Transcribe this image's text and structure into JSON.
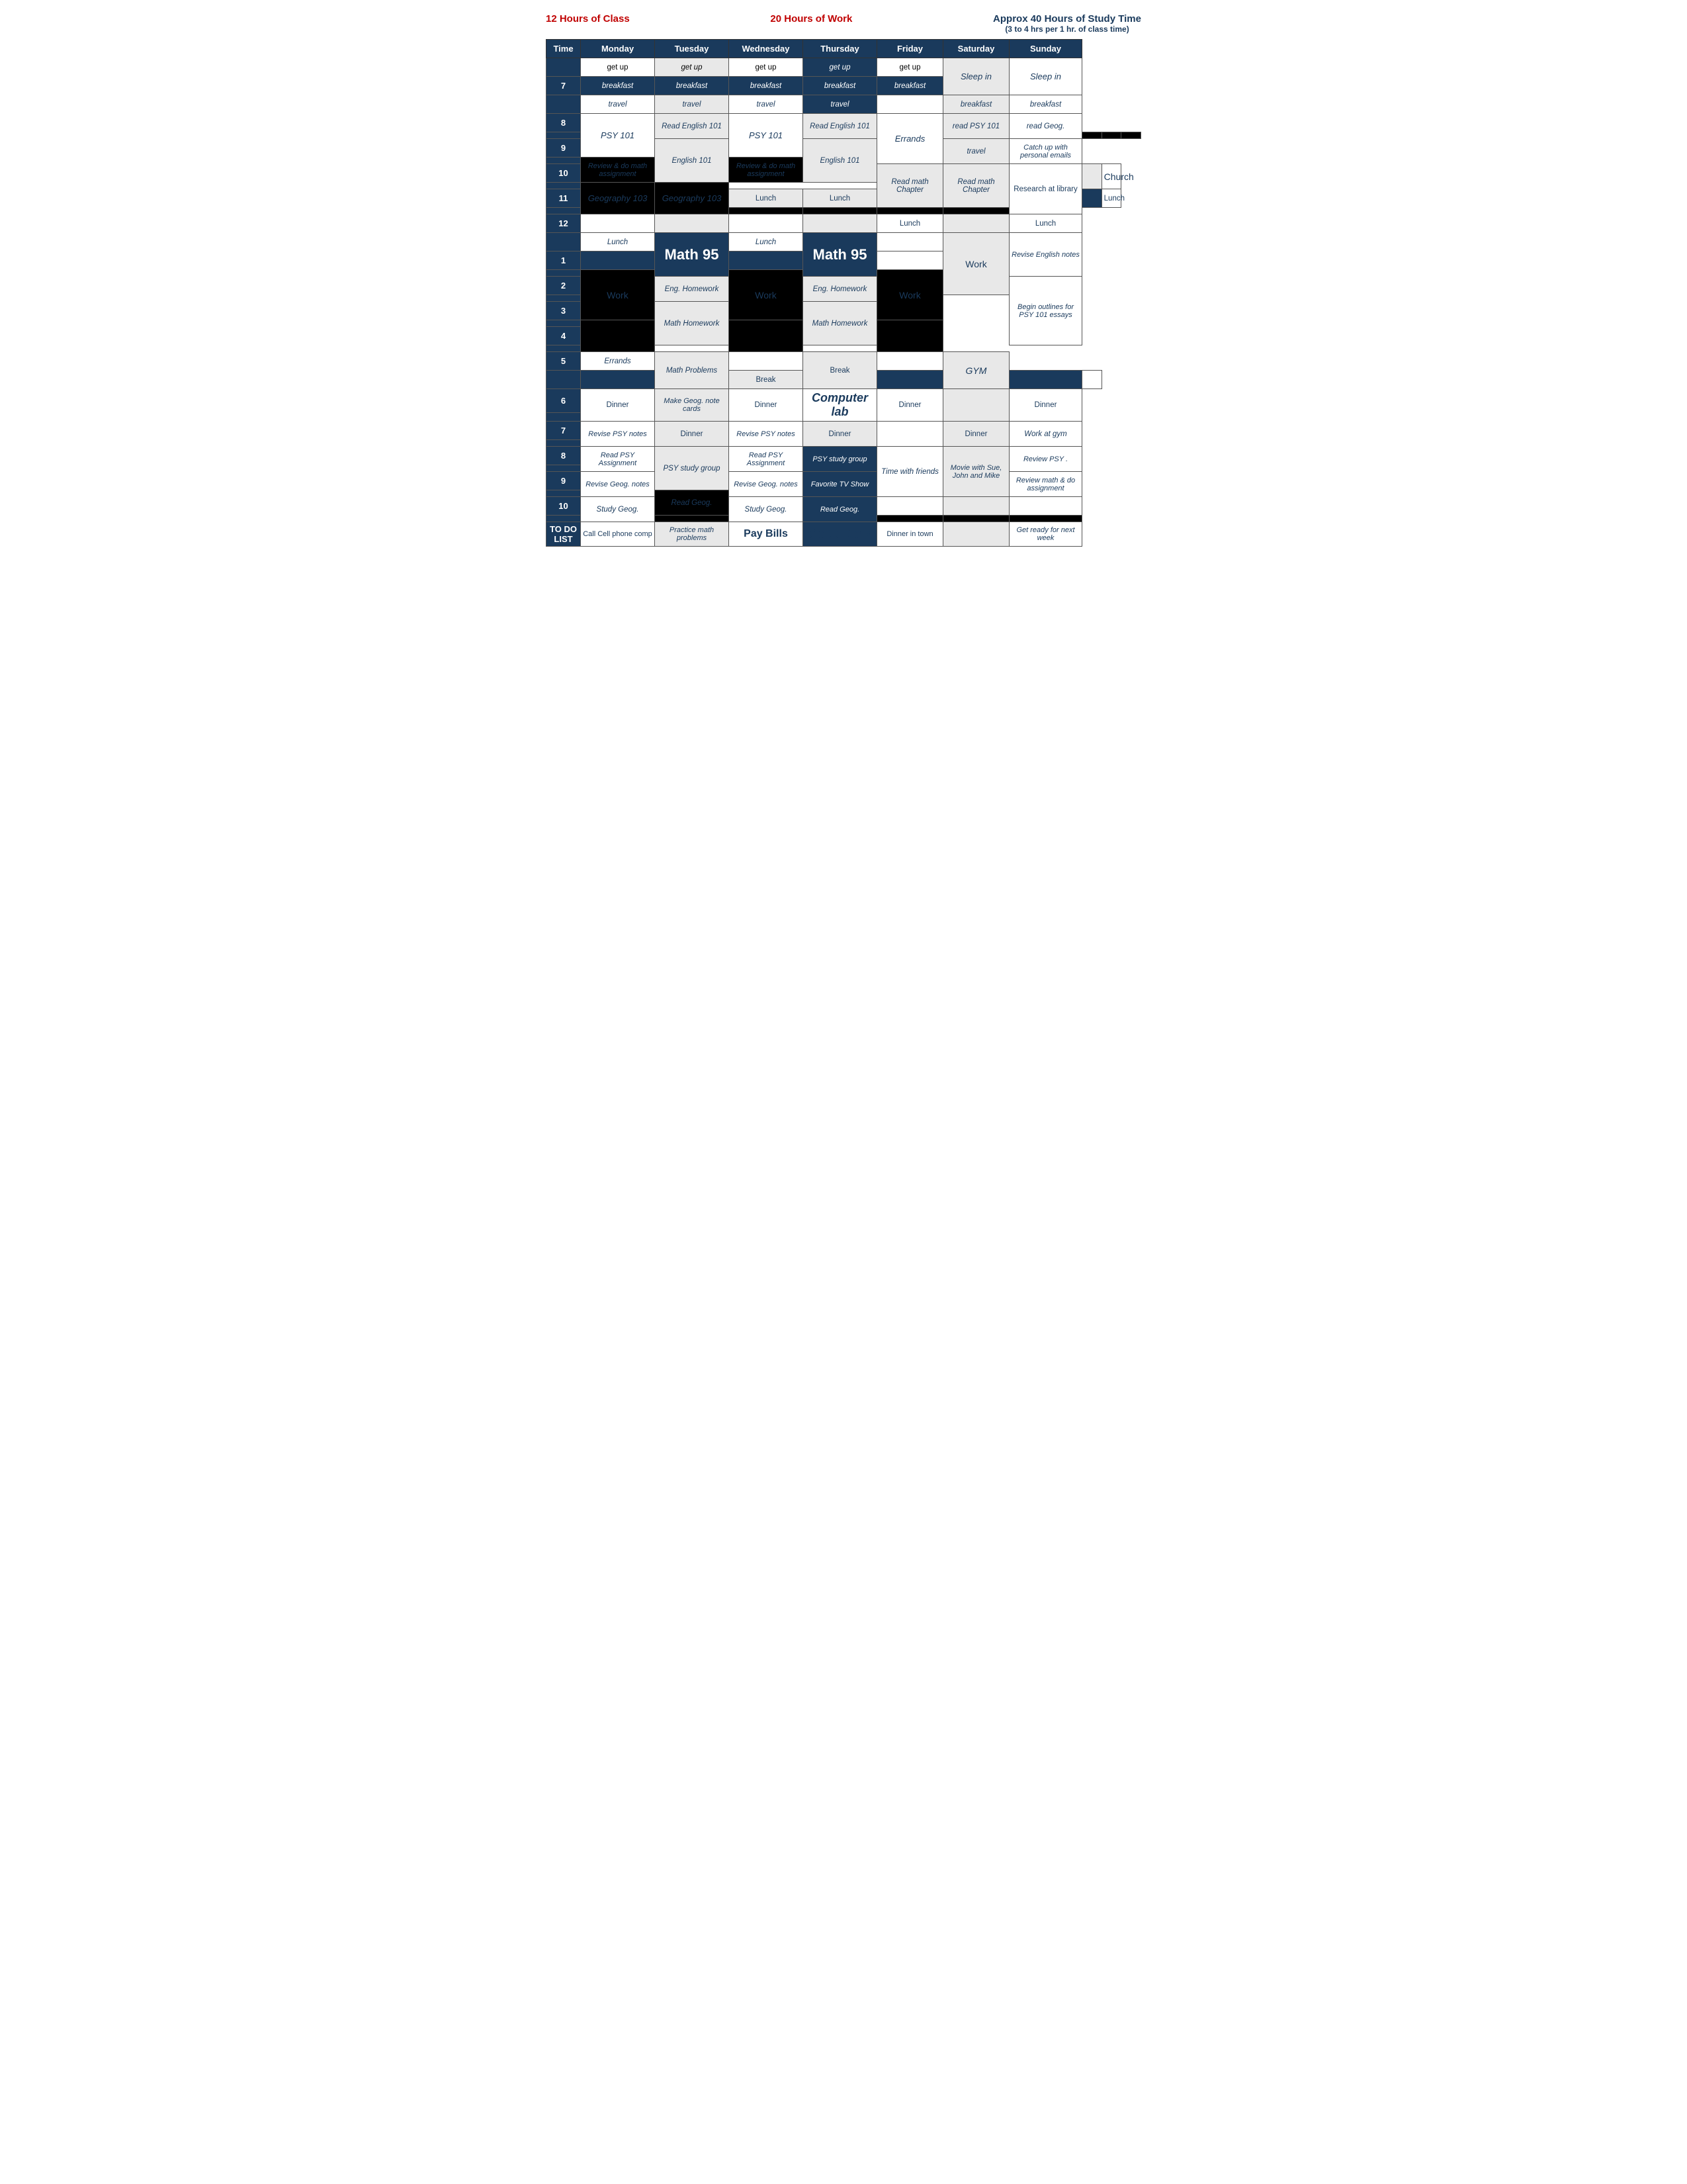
{
  "header": {
    "col1_title": "12 Hours of Class",
    "col2_title": "20 Hours of Work",
    "col3_title": "Approx 40 Hours of Study Time",
    "col3_subtitle": "(3 to 4 hrs per 1 hr. of class time)"
  },
  "columns": [
    "Time",
    "Monday",
    "Tuesday",
    "Wednesday",
    "Thursday",
    "Friday",
    "Saturday",
    "Sunday"
  ]
}
